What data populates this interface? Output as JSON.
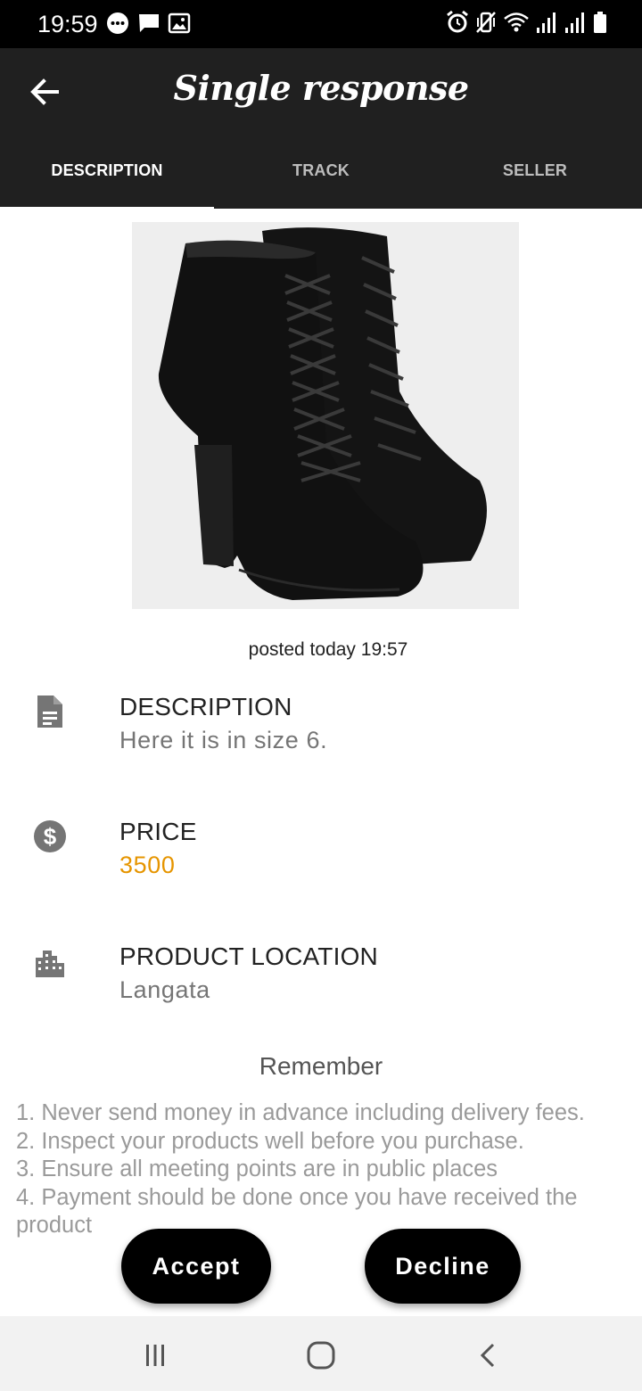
{
  "status_bar": {
    "time": "19:59",
    "left_icons": [
      "chat-bubble-icon",
      "message-icon",
      "image-icon"
    ],
    "right_icons": [
      "alarm-icon",
      "vibrate-icon",
      "wifi-icon",
      "signal-icon",
      "signal-icon",
      "battery-icon"
    ]
  },
  "app_bar": {
    "back_icon": "arrow-left-icon",
    "title": "Single response"
  },
  "tabs": [
    {
      "label": "DESCRIPTION",
      "active": true
    },
    {
      "label": "TRACK",
      "active": false
    },
    {
      "label": "SELLER",
      "active": false
    }
  ],
  "product": {
    "image": "black-lace-up-heeled-ankle-boots",
    "posted": "posted today 19:57"
  },
  "details": [
    {
      "icon": "document-icon",
      "label": "DESCRIPTION",
      "value": "Here it is in size 6."
    },
    {
      "icon": "dollar-circle-icon",
      "label": "PRICE",
      "value": "3500"
    },
    {
      "icon": "building-icon",
      "label": "PRODUCT LOCATION",
      "value": "Langata"
    }
  ],
  "colors": {
    "price": "#e69500",
    "app_bar": "#202020"
  },
  "remember": {
    "title": "Remember",
    "items": [
      "1. Never send money in advance including delivery fees.",
      "2. Inspect your products well before you purchase.",
      "3. Ensure all meeting points are in public places",
      "4. Payment should be done once you have received the product"
    ]
  },
  "actions": {
    "accept": "Accept",
    "decline": "Decline"
  },
  "nav_bar": {
    "icons": [
      "recent-apps-icon",
      "home-icon",
      "back-icon"
    ]
  }
}
